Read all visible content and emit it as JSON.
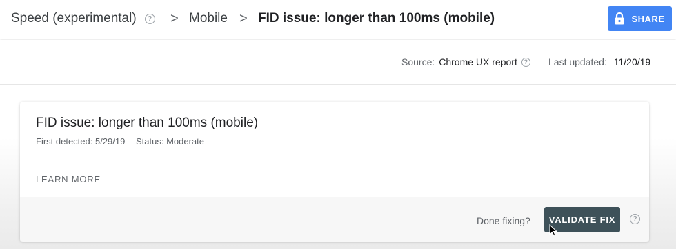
{
  "header": {
    "breadcrumb": [
      "Speed (experimental)",
      "Mobile",
      "FID issue: longer than 100ms (mobile)"
    ],
    "separator": ">",
    "share_label": "SHARE",
    "accent_color": "#4285f4"
  },
  "info_bar": {
    "source_label": "Source:",
    "source_value": "Chrome UX report",
    "updated_label": "Last updated:",
    "updated_value": "11/20/19"
  },
  "issue_card": {
    "title": "FID issue: longer than 100ms (mobile)",
    "first_detected": "First detected: 5/29/19",
    "status": "Status: Moderate",
    "learn_more_label": "LEARN MORE",
    "done_fixing_label": "Done fixing?",
    "validate_label": "VALIDATE FIX",
    "validate_color": "#3e5159"
  },
  "icons": [
    "help-icon",
    "chevron-right-icon",
    "lock-icon",
    "cursor-icon"
  ]
}
